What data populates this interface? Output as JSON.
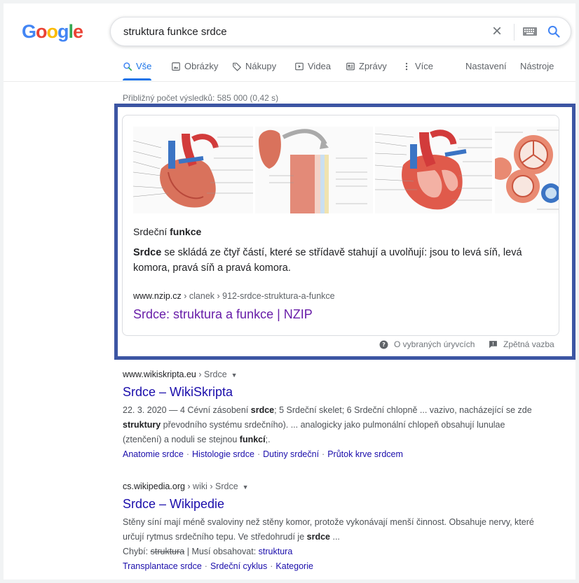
{
  "logo": {
    "letters": [
      "G",
      "o",
      "o",
      "g",
      "l",
      "e"
    ]
  },
  "search": {
    "query": "struktura funkce srdce"
  },
  "tabs": [
    {
      "label": "Vše",
      "icon": "search-icon"
    },
    {
      "label": "Obrázky",
      "icon": "image-icon"
    },
    {
      "label": "Nákupy",
      "icon": "tag-icon"
    },
    {
      "label": "Videa",
      "icon": "play-icon"
    },
    {
      "label": "Zprávy",
      "icon": "news-icon"
    },
    {
      "label": "Více",
      "icon": "more-vert-icon"
    }
  ],
  "tools": {
    "settings": "Nastavení",
    "tools": "Nástroje"
  },
  "stats": "Přibližný počet výsledků: 585 000 (0,42 s)",
  "featured": {
    "title_plain": "Srdeční ",
    "title_bold": "funkce",
    "text_bold": "Srdce",
    "text_rest": " se skládá ze čtyř částí, které se střídavě stahují a uvolňují: jsou to levá síň, levá komora, pravá síň a pravá komora.",
    "url_domain": "www.nzip.cz",
    "url_path": " › clanek › 912-srdce-struktura-a-funkce",
    "link": "Srdce: struktura a funkce | NZIP",
    "footer_about": "O vybraných úryvcích",
    "footer_feedback": "Zpětná vazba"
  },
  "results": [
    {
      "domain": "www.wikiskripta.eu",
      "path": " › Srdce",
      "title": "Srdce – WikiSkripta",
      "snippet": [
        {
          "t": "22. 3. 2020 — 4 Cévní zásobení "
        },
        {
          "b": "srdce"
        },
        {
          "t": "; 5 Srdeční skelet; 6 Srdeční chlopně ... vazivo, nacházející se zde "
        },
        {
          "b": "struktury"
        },
        {
          "t": " převodního systému srdečního). ... analogicky jako pulmonální chlopeň obsahují lunulae (ztenčení) a noduli se stejnou "
        },
        {
          "b": "funkcí"
        },
        {
          "t": ";."
        }
      ],
      "sitelinks": [
        "Anatomie srdce",
        "Histologie srdce",
        "Dutiny srdeční",
        "Průtok krve srdcem"
      ]
    },
    {
      "domain": "cs.wikipedia.org",
      "path": " › wiki › Srdce",
      "title": "Srdce – Wikipedie",
      "snippet": [
        {
          "t": "Stěny síní mají méně svaloviny než stěny komor, protože vykonávají menší činnost. Obsahuje nervy, které určují rytmus srdečního tepu. Ve středohrudí je "
        },
        {
          "b": "srdce"
        },
        {
          "t": " ..."
        }
      ],
      "missing_label": "Chybí: ",
      "missing_word": "struktura",
      "must_label": " | Musí obsahovat: ",
      "must_word": "struktura",
      "sitelinks": [
        "Transplantace srdce",
        "Srdeční cyklus",
        "Kategorie"
      ]
    }
  ],
  "colors": {
    "accent": "#1a73e8",
    "link": "#1a0dab",
    "visited": "#681da8",
    "frame": "#3c55a3",
    "logo_blue": "#4285f4",
    "logo_red": "#ea4335",
    "logo_yellow": "#fbbc05",
    "logo_green": "#34a853"
  }
}
